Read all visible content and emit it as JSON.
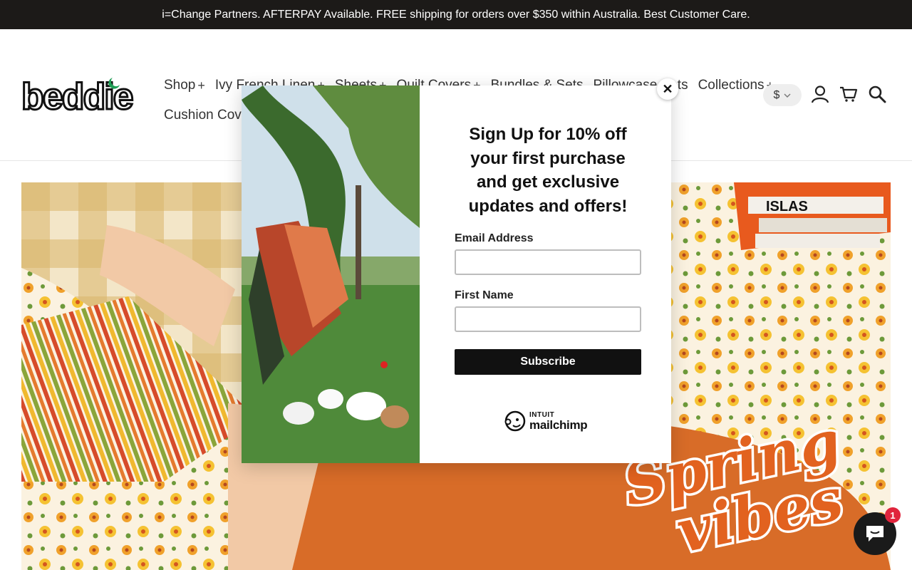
{
  "announcement": {
    "text": "i=Change Partners. AFTERPAY Available. FREE shipping for orders over $350 within Australia. Best Customer Care."
  },
  "header": {
    "logo_text": "beddie",
    "nav_row1": [
      {
        "label": "Shop",
        "has_submenu": true
      },
      {
        "label": "Ivy French Linen",
        "has_submenu": true
      },
      {
        "label": "Sheets",
        "has_submenu": true
      },
      {
        "label": "Quilt Covers",
        "has_submenu": true
      },
      {
        "label": "Bundles & Sets",
        "has_submenu": false
      },
      {
        "label": "Pillowcase Sets",
        "has_submenu": false
      },
      {
        "label": "Collections",
        "has_submenu": true
      }
    ],
    "nav_row2": [
      {
        "label": "Cushion Cove",
        "has_submenu": false
      }
    ],
    "submenu_symbol": "+",
    "currency": "$",
    "icons": [
      "account-icon",
      "cart-icon",
      "search-icon"
    ]
  },
  "hero": {
    "headline_line1": "Spring",
    "headline_line2": "vibes",
    "book_label": "ISLAS"
  },
  "popup": {
    "title": "Sign Up for 10% off your first purchase and get exclusive updates and offers!",
    "email_label": "Email Address",
    "email_value": "",
    "first_name_label": "First Name",
    "first_name_value": "",
    "subscribe_label": "Subscribe",
    "brand_small": "INTUIT",
    "brand_large": "mailchimp",
    "close_symbol": "✕"
  },
  "chat": {
    "badge_count": "1"
  },
  "colors": {
    "announcement_bg": "#1c1a18",
    "accent_green": "#1f9d55",
    "hero_orange": "#e0742a",
    "badge_red": "#e0243c"
  }
}
